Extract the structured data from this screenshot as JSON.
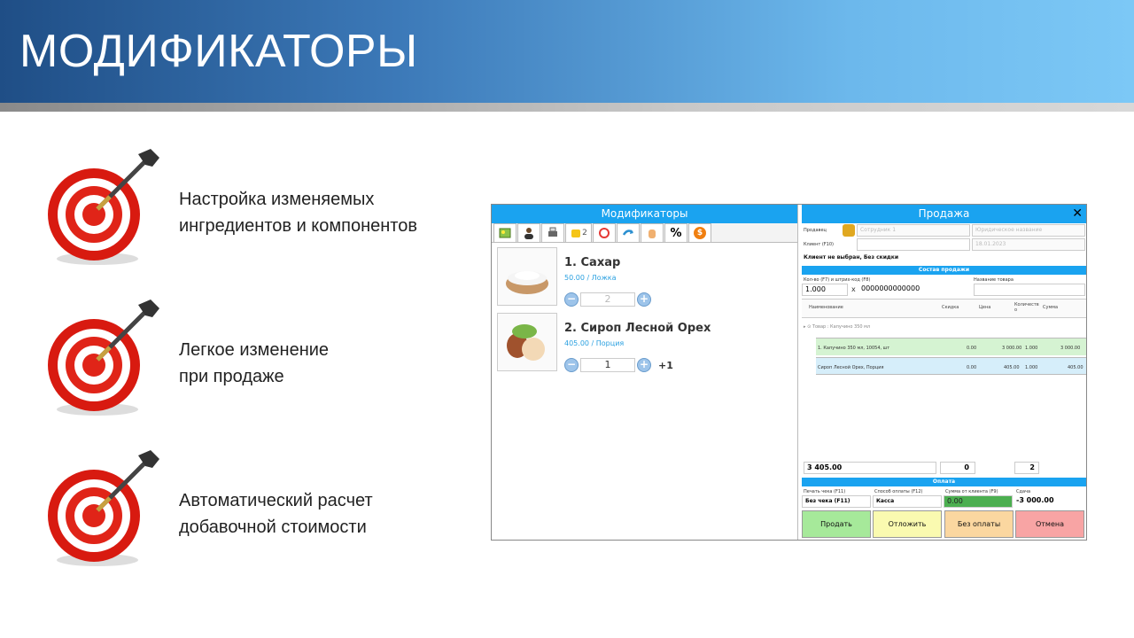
{
  "slide": {
    "title": "МОДИФИКАТОРЫ",
    "bullets": [
      {
        "text": "Настройка изменяемых\nингредиентов и компонентов",
        "icon": "dart-target-icon"
      },
      {
        "text": "Легкое изменение\nпри продаже",
        "icon": "dart-target-icon"
      },
      {
        "text": "Автоматический расчет\nдобавочной стоимости",
        "icon": "dart-target-icon"
      }
    ]
  },
  "modifiers_panel": {
    "title": "Модификаторы",
    "tabs": [
      "image-icon",
      "user-icon",
      "printer-icon",
      "puzzle-icon",
      "clock-icon",
      "redo-icon",
      "hand-icon",
      "%",
      "$"
    ],
    "active_tab_count": "2",
    "items": [
      {
        "name": "1. Сахар",
        "price": "50.00 / Ложка",
        "qty": "2",
        "extra": "",
        "image": "sugar-bowl-image"
      },
      {
        "name": "2. Сироп Лесной Орех",
        "price": "405.00 / Порция",
        "qty": "1",
        "extra": "+1",
        "image": "hazelnut-image"
      }
    ]
  },
  "sale_panel": {
    "title": "Продажа",
    "seller_label": "Продавец",
    "seller_value": "Сотрудник 1",
    "legal_name": "Юридическое название",
    "client_label": "Клиент (F10)",
    "date": "18.01.2023",
    "client_status": "Клиент не выбран, Без скидки",
    "composition_title": "Состав продажи",
    "qty_label": "Кол-во (F7) и штрих-код (F8)",
    "qty_value": "1.000",
    "times": "x",
    "barcode": "0000000000000",
    "product_name_label": "Название товара",
    "columns": [
      "Наименование",
      "Скидка",
      "Цена",
      "Количество",
      "Сумма"
    ],
    "group_row": "Товар : Капучино 350 мл",
    "rows": [
      {
        "name": "1. Капучино 350 мл, 10054, шт",
        "discount": "0.00",
        "price": "3 000.00",
        "qty": "1.000",
        "sum": "3 000.00"
      },
      {
        "name": "Сироп Лесной Орех, Порция",
        "discount": "0.00",
        "price": "405.00",
        "qty": "1.000",
        "sum": "405.00"
      }
    ],
    "total": "3 405.00",
    "total_discount": "0",
    "total_count": "2",
    "payment_title": "Оплата",
    "receipt_label": "Печать чека (F11)",
    "receipt_value": "Без чека (F11)",
    "pay_method_label": "Способ оплаты (F12)",
    "pay_method_value": "Касса",
    "client_sum_label": "Сумма от клиента (F9)",
    "client_sum_value": "0.00",
    "change_label": "Сдача",
    "change_value": "-3 000.00",
    "buttons": {
      "sell": "Продать",
      "postpone": "Отложить",
      "no_payment": "Без оплаты",
      "cancel": "Отмена"
    }
  },
  "colors": {
    "accent": "#1aa3f0",
    "sell": "#a6e99a",
    "postpone": "#fafab0",
    "no_payment": "#fbd7a0",
    "cancel": "#f8a4a4"
  }
}
